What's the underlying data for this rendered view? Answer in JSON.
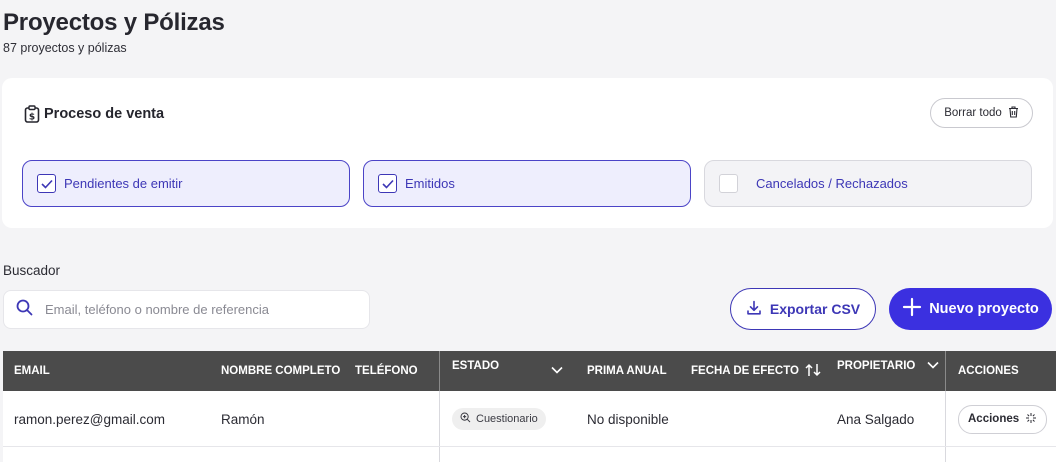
{
  "page": {
    "title": "Proyectos y Pólizas",
    "subtitle": "87 proyectos y pólizas"
  },
  "filters": {
    "heading": "Proceso de venta",
    "clear_label": "Borrar todo",
    "options": [
      {
        "label": "Pendientes de emitir",
        "checked": true
      },
      {
        "label": "Emitidos",
        "checked": true
      },
      {
        "label": "Cancelados / Rechazados",
        "checked": false
      }
    ]
  },
  "search": {
    "label": "Buscador",
    "placeholder": "Email, teléfono o nombre de referencia",
    "value": ""
  },
  "actions": {
    "export_label": "Exportar CSV",
    "new_label": "Nuevo proyecto"
  },
  "table": {
    "columns": [
      "EMAIL",
      "NOMBRE COMPLETO",
      "TELÉFONO",
      "ESTADO",
      "PRIMA ANUAL",
      "FECHA DE EFECTO",
      "PROPIETARIO",
      "ACCIONES"
    ],
    "rows": [
      {
        "email": "ramon.perez@gmail.com",
        "name": "Ramón",
        "phone": "",
        "status": "Cuestionario",
        "premium": "No disponible",
        "effective_date": "",
        "owner": "Ana Salgado",
        "actions_label": "Acciones"
      }
    ]
  },
  "colors": {
    "accent": "#3b30e0",
    "accent_text": "#3d37b6",
    "header_bg": "#4b4b4b"
  }
}
